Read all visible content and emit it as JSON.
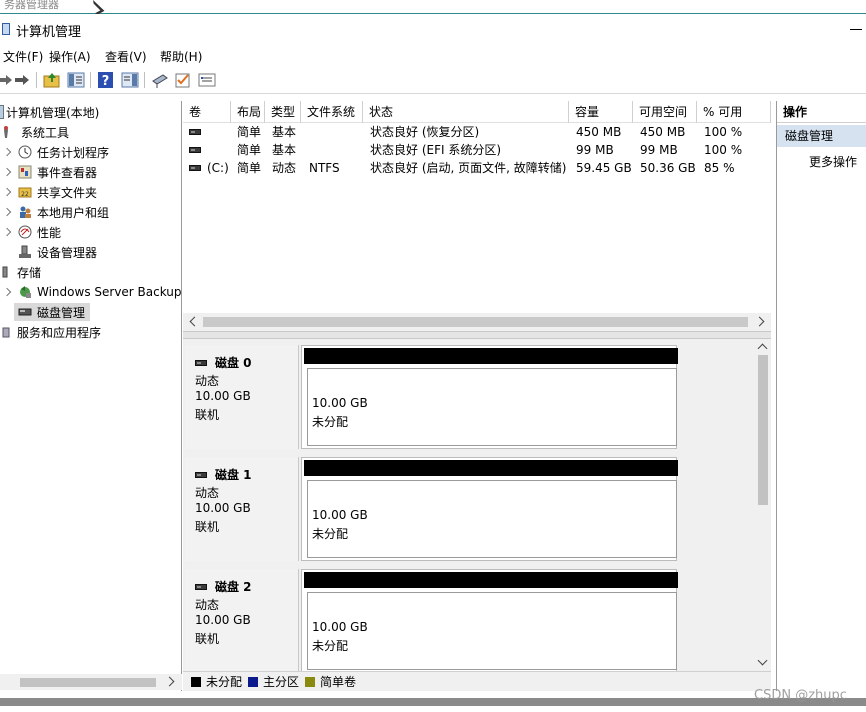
{
  "top_strip_text": "务器管理器",
  "window": {
    "title": "计算机管理"
  },
  "menu": [
    "文件(F)",
    "操作(A)",
    "查看(V)",
    "帮助(H)"
  ],
  "tree": {
    "root": "计算机管理(本地)",
    "system_tools": "系统工具",
    "task_scheduler": "任务计划程序",
    "event_viewer": "事件查看器",
    "shared_folders": "共享文件夹",
    "local_users": "本地用户和组",
    "performance": "性能",
    "device_manager": "设备管理器",
    "storage": "存储",
    "windows_backup": "Windows Server Backup",
    "disk_management": "磁盘管理",
    "services_apps": "服务和应用程序"
  },
  "volume_list": {
    "columns": [
      "卷",
      "布局",
      "类型",
      "文件系统",
      "状态",
      "容量",
      "可用空间",
      "% 可用"
    ],
    "rows": [
      {
        "vol": "",
        "layout": "简单",
        "type": "基本",
        "fs": "",
        "status": "状态良好 (恢复分区)",
        "capacity": "450 MB",
        "free": "450 MB",
        "pct": "100 %"
      },
      {
        "vol": "",
        "layout": "简单",
        "type": "基本",
        "fs": "",
        "status": "状态良好 (EFI 系统分区)",
        "capacity": "99 MB",
        "free": "99 MB",
        "pct": "100 %"
      },
      {
        "vol": "(C:)",
        "layout": "简单",
        "type": "动态",
        "fs": "NTFS",
        "status": "状态良好 (启动, 页面文件, 故障转储)",
        "capacity": "59.45 GB",
        "free": "50.36 GB",
        "pct": "85 %"
      }
    ]
  },
  "disks": [
    {
      "name": "磁盘 0",
      "kind": "动态",
      "size": "10.00 GB",
      "state": "联机",
      "part_size": "10.00 GB",
      "part_status": "未分配"
    },
    {
      "name": "磁盘 1",
      "kind": "动态",
      "size": "10.00 GB",
      "state": "联机",
      "part_size": "10.00 GB",
      "part_status": "未分配"
    },
    {
      "name": "磁盘 2",
      "kind": "动态",
      "size": "10.00 GB",
      "state": "联机",
      "part_size": "10.00 GB",
      "part_status": "未分配"
    }
  ],
  "legend": [
    {
      "label": "未分配",
      "color": "#000000"
    },
    {
      "label": "主分区",
      "color": "#0a1a8c"
    },
    {
      "label": "简单卷",
      "color": "#8a8a10"
    }
  ],
  "actions": {
    "header": "操作",
    "section": "磁盘管理",
    "more": "更多操作"
  },
  "watermark": "CSDN @zhupc"
}
